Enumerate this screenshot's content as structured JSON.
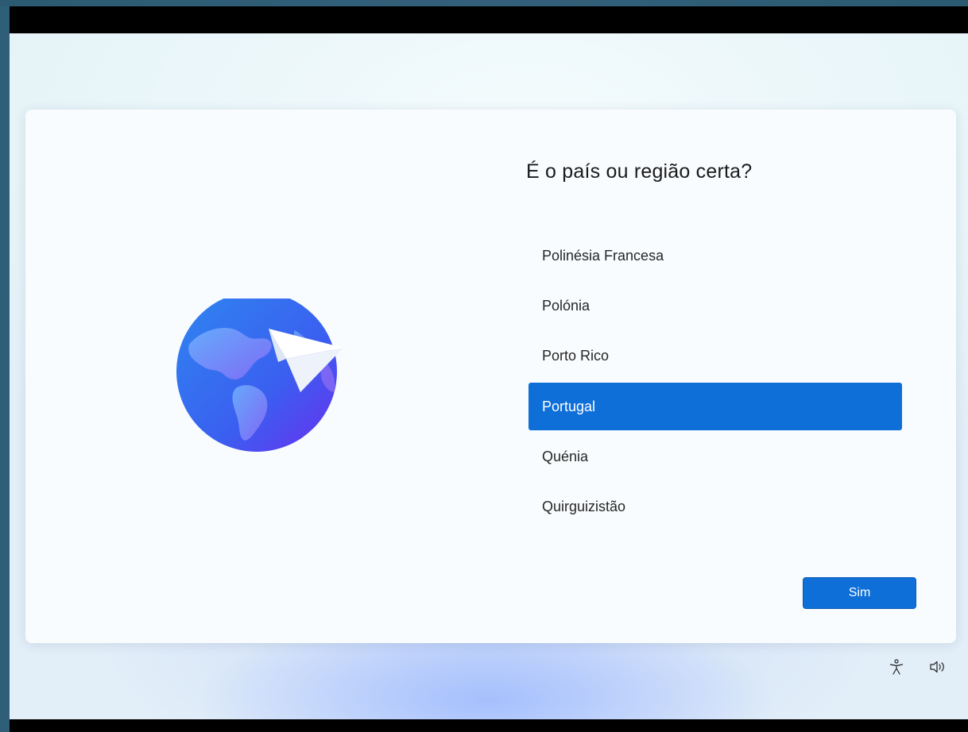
{
  "setup": {
    "question": "É o país ou região certa?",
    "countries": [
      {
        "label": "Polinésia Francesa",
        "selected": false
      },
      {
        "label": "Polónia",
        "selected": false
      },
      {
        "label": "Porto Rico",
        "selected": false
      },
      {
        "label": "Portugal",
        "selected": true
      },
      {
        "label": "Quénia",
        "selected": false
      },
      {
        "label": "Quirguizistão",
        "selected": false
      }
    ],
    "confirm_label": "Sim"
  },
  "tray": {
    "icons": [
      "accessibility-icon",
      "volume-icon"
    ]
  },
  "colors": {
    "accent": "#0f6fd8",
    "dialog_bg": "#f9fcfe",
    "text": "#1a1a1a"
  }
}
